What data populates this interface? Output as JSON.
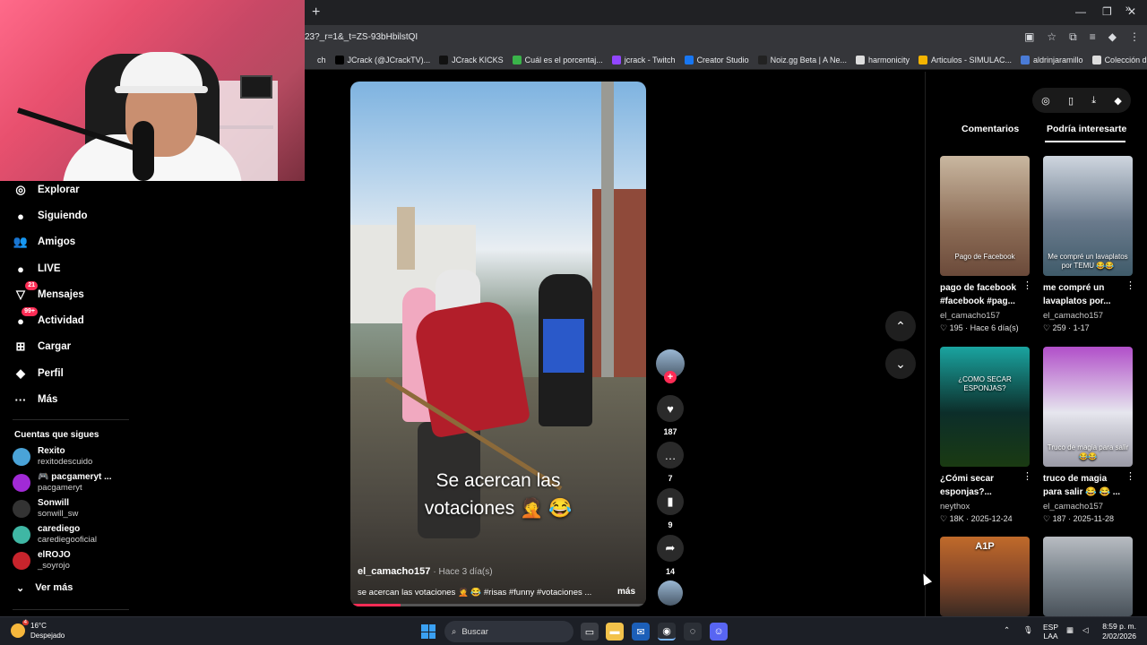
{
  "browser": {
    "new_tab": "+",
    "url": "23?_r=1&_t=ZS-93bHbilstQI",
    "bookmarks": [
      {
        "label": "ch",
        "color": "#35363a"
      },
      {
        "label": "JCrack (@JCrackTV)...",
        "color": "#000000"
      },
      {
        "label": "JCrack KICKS",
        "color": "#111111"
      },
      {
        "label": "Cuál es el porcentaj...",
        "color": "#3ab44a"
      },
      {
        "label": "jcrack - Twitch",
        "color": "#9146ff"
      },
      {
        "label": "Creator Studio",
        "color": "#1877f2"
      },
      {
        "label": "Noiz.gg Beta | A Ne...",
        "color": "#222222"
      },
      {
        "label": "harmonicity",
        "color": "#dddddd"
      },
      {
        "label": "Articulos - SIMULAC...",
        "color": "#f4b400"
      },
      {
        "label": "aldrinjaramillo",
        "color": "#4a7bd6"
      },
      {
        "label": "Colección de M_blei...",
        "color": "#dddddd"
      }
    ],
    "more": "»"
  },
  "nav": {
    "items": [
      {
        "label": "Explorar",
        "icon": "compass-icon",
        "glyph": "◎",
        "badge": ""
      },
      {
        "label": "Siguiendo",
        "icon": "following-icon",
        "glyph": "●",
        "badge": ""
      },
      {
        "label": "Amigos",
        "icon": "friends-icon",
        "glyph": "👥",
        "badge": ""
      },
      {
        "label": "LIVE",
        "icon": "live-icon",
        "glyph": "●",
        "badge": ""
      },
      {
        "label": "Mensajes",
        "icon": "messages-icon",
        "glyph": "▽",
        "badge": "21"
      },
      {
        "label": "Actividad",
        "icon": "activity-icon",
        "glyph": "●",
        "badge": "99+"
      },
      {
        "label": "Cargar",
        "icon": "upload-icon",
        "glyph": "⊞",
        "badge": ""
      },
      {
        "label": "Perfil",
        "icon": "profile-icon",
        "glyph": "◆",
        "badge": ""
      },
      {
        "label": "Más",
        "icon": "more-icon",
        "glyph": "···",
        "badge": ""
      }
    ],
    "following_title": "Cuentas que sigues",
    "following": [
      {
        "name": "Rexito",
        "handle": "rexitodescuido",
        "color": "#4aa3d8"
      },
      {
        "name": "🎮 pacgameryt ...",
        "handle": "pacgameryt",
        "color": "#a12ad6"
      },
      {
        "name": "Sonwill",
        "handle": "sonwill_sw",
        "color": "#333333"
      },
      {
        "name": "carediego",
        "handle": "carediegooficial",
        "color": "#3fb7a4"
      },
      {
        "name": "elROJO",
        "handle": "_soyrojo",
        "color": "#c8242c"
      }
    ],
    "see_more": "Ver más"
  },
  "video": {
    "caption_line1": "Se acercan las",
    "caption_line2": "votaciones 🤦 😂",
    "author": "el_camacho157",
    "time": "· Hace 3 día(s)",
    "description": "se acercan las votaciones 🤦 😂 #risas #funny #votaciones ...",
    "more": "más",
    "progress": 0.17
  },
  "actions": {
    "plus": "+",
    "likes": "187",
    "comments": "7",
    "saves": "9",
    "shares": "14"
  },
  "panel": {
    "tab_comments": "Comentarios",
    "tab_interesting": "Podría interesarte",
    "cards": [
      {
        "title": "pago de facebook #facebook #pag...",
        "author": "el_camacho157",
        "meta": "♡ 195 · Hace 6 día(s)",
        "overlay": "Pago de Facebook",
        "bg": "linear-gradient(180deg,#c9b7a0,#8b6b55 60%,#6b4a3a)"
      },
      {
        "title": "me compré un lavaplatos por...",
        "author": "el_camacho157",
        "meta": "♡ 259 · 1-17",
        "overlay": "Me compré un lavaplatos por TEMU 😂😂",
        "bg": "linear-gradient(180deg,#cfd6df,#6a7a8c 55%,#3f5b6a)"
      },
      {
        "title": "¿Cómi secar esponjas?...",
        "author": "neythox",
        "meta": "♡ 18K · 2025-12-24",
        "overlay": "¿COMO SECAR ESPONJAS?",
        "bg": "linear-gradient(180deg,#1aa4a0,#0c2e2a 55%,#1a3a12)"
      },
      {
        "title": "truco de magia para salir 😂 😂 ...",
        "author": "el_camacho157",
        "meta": "♡ 187 · 2025-11-28",
        "overlay": "Truco de magia para salir 😂😂",
        "bg": "linear-gradient(180deg,#b14fc9,#e6e6ee 55%,#9a9aa6)"
      },
      {
        "title": "",
        "author": "",
        "meta": "",
        "overlay": "A1P",
        "bg": "linear-gradient(180deg,#c06a2a,#8a4a2a 50%,#3a2a22)"
      },
      {
        "title": "",
        "author": "",
        "meta": "",
        "overlay": "",
        "bg": "linear-gradient(180deg,#b8bcc2,#7a848c 50%,#4a525a)"
      }
    ]
  },
  "taskbar": {
    "temp": "16°C",
    "weather": "Despejado",
    "weather_badge": "4",
    "search_placeholder": "Buscar",
    "lang1": "ESP",
    "lang2": "LAA",
    "time": "8:59 p. m.",
    "date": "2/02/2026"
  }
}
